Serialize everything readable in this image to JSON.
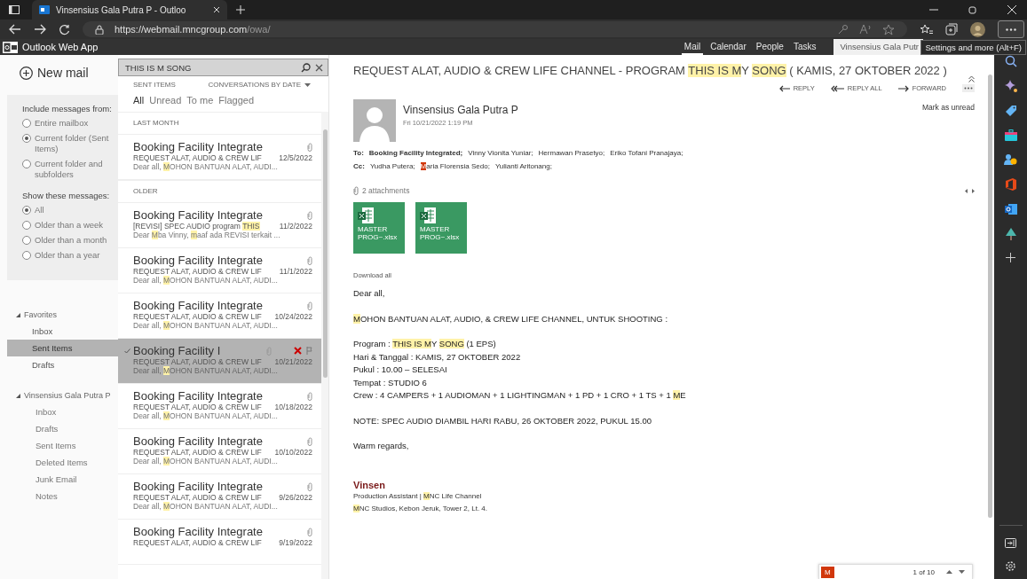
{
  "browser": {
    "tab_title": "Vinsensius Gala Putra P - Outloo",
    "url_host": "https://webmail.mncgroup.com",
    "url_path": "/owa/",
    "tooltip": "Settings and more (Alt+F)"
  },
  "app": {
    "title": "Outlook Web App",
    "nav": [
      {
        "label": "Mail",
        "selected": true
      },
      {
        "label": "Calendar",
        "selected": false
      },
      {
        "label": "People",
        "selected": false
      },
      {
        "label": "Tasks",
        "selected": false
      }
    ],
    "user": "Vinsensius Gala Putr"
  },
  "sidebar": {
    "new_mail": "New mail",
    "include": {
      "title": "Include messages from:",
      "options": [
        {
          "label": "Entire mailbox",
          "selected": false
        },
        {
          "label": "Current folder (Sent Items)",
          "selected": true
        },
        {
          "label": "Current folder and subfolders",
          "selected": false
        }
      ]
    },
    "show": {
      "title": "Show these messages:",
      "options": [
        {
          "label": "All",
          "selected": true
        },
        {
          "label": "Older than a week",
          "selected": false
        },
        {
          "label": "Older than a month",
          "selected": false
        },
        {
          "label": "Older than a year",
          "selected": false
        }
      ]
    },
    "sections": [
      {
        "label": "Favorites",
        "expanded": true,
        "children": [
          {
            "label": "Inbox",
            "selected": false
          },
          {
            "label": "Sent Items",
            "selected": true
          },
          {
            "label": "Drafts",
            "selected": false
          }
        ]
      },
      {
        "label": "Vinsensius Gala Putra P",
        "expanded": true,
        "children": [
          {
            "label": "Inbox",
            "selected": false
          },
          {
            "label": "Drafts",
            "selected": false
          },
          {
            "label": "Sent Items",
            "selected": false
          },
          {
            "label": "Deleted Items",
            "selected": false
          },
          {
            "label": "Junk Email",
            "selected": false
          },
          {
            "label": "Notes",
            "selected": false
          }
        ]
      }
    ]
  },
  "list": {
    "search": "THIS IS M SONG",
    "folder": "SENT ITEMS",
    "sort": "CONVERSATIONS BY DATE",
    "filters": [
      {
        "label": "All",
        "selected": true
      },
      {
        "label": "Unread",
        "selected": false
      },
      {
        "label": "To me",
        "selected": false
      },
      {
        "label": "Flagged",
        "selected": false
      }
    ],
    "groups": [
      {
        "label": "LAST MONTH",
        "items": [
          {
            "sender": "Booking Facility Integrate",
            "subject": [
              {
                "text": "REQUEST ALAT, AUDIO & CREW LIF",
                "highlight": false
              }
            ],
            "date": "12/5/2022",
            "preview": [
              {
                "text": "Dear all, ",
                "highlight": false
              },
              {
                "text": "M",
                "highlight": true
              },
              {
                "text": "OHON BANTUAN ALAT, AUDI...",
                "highlight": false
              }
            ],
            "selected": false
          }
        ]
      },
      {
        "label": "OLDER",
        "items": [
          {
            "sender": "Booking Facility Integrate",
            "subject": [
              {
                "text": "[REVISI] SPEC AUDIO program ",
                "highlight": false
              },
              {
                "text": "THIS",
                "highlight": true
              }
            ],
            "date": "11/2/2022",
            "preview": [
              {
                "text": "Dear ",
                "highlight": false
              },
              {
                "text": "M",
                "highlight": true
              },
              {
                "text": "ba Vinny, ",
                "highlight": false
              },
              {
                "text": "m",
                "highlight": true
              },
              {
                "text": "aaf ada REVISI terkait ...",
                "highlight": false
              }
            ],
            "selected": false
          },
          {
            "sender": "Booking Facility Integrate",
            "subject": [
              {
                "text": "REQUEST ALAT, AUDIO & CREW LIF",
                "highlight": false
              }
            ],
            "date": "11/1/2022",
            "preview": [
              {
                "text": "Dear all, ",
                "highlight": false
              },
              {
                "text": "M",
                "highlight": true
              },
              {
                "text": "OHON BANTUAN ALAT, AUDI...",
                "highlight": false
              }
            ],
            "selected": false
          },
          {
            "sender": "Booking Facility Integrate",
            "subject": [
              {
                "text": "REQUEST ALAT, AUDIO & CREW LIF",
                "highlight": false
              }
            ],
            "date": "10/24/2022",
            "preview": [
              {
                "text": "Dear all, ",
                "highlight": false
              },
              {
                "text": "M",
                "highlight": true
              },
              {
                "text": "OHON BANTUAN ALAT, AUDI...",
                "highlight": false
              }
            ],
            "selected": false
          },
          {
            "sender": "Booking Facility I",
            "subject": [
              {
                "text": "REQUEST ALAT, AUDIO & CREW LIF",
                "highlight": false
              }
            ],
            "date": "10/21/2022",
            "preview": [
              {
                "text": "Dear all, ",
                "highlight": false
              },
              {
                "text": "M",
                "highlight": true
              },
              {
                "text": "OHON BANTUAN ALAT, AUDI...",
                "highlight": false
              }
            ],
            "selected": true
          },
          {
            "sender": "Booking Facility Integrate",
            "subject": [
              {
                "text": "REQUEST ALAT, AUDIO & CREW LIF",
                "highlight": false
              }
            ],
            "date": "10/18/2022",
            "preview": [
              {
                "text": "Dear all, ",
                "highlight": false
              },
              {
                "text": "M",
                "highlight": true
              },
              {
                "text": "OHON BANTUAN ALAT, AUDI...",
                "highlight": false
              }
            ],
            "selected": false
          },
          {
            "sender": "Booking Facility Integrate",
            "subject": [
              {
                "text": "REQUEST ALAT, AUDIO & CREW LIF",
                "highlight": false
              }
            ],
            "date": "10/10/2022",
            "preview": [
              {
                "text": "Dear all, ",
                "highlight": false
              },
              {
                "text": "M",
                "highlight": true
              },
              {
                "text": "OHON BANTUAN ALAT, AUDI...",
                "highlight": false
              }
            ],
            "selected": false
          },
          {
            "sender": "Booking Facility Integrate",
            "subject": [
              {
                "text": "REQUEST ALAT, AUDIO & CREW LIF",
                "highlight": false
              }
            ],
            "date": "9/26/2022",
            "preview": [
              {
                "text": "Dear all, ",
                "highlight": false
              },
              {
                "text": "M",
                "highlight": true
              },
              {
                "text": "OHON BANTUAN ALAT, AUDI...",
                "highlight": false
              }
            ],
            "selected": false
          },
          {
            "sender": "Booking Facility Integrate",
            "subject": [
              {
                "text": "REQUEST ALAT, AUDIO & CREW LIF",
                "highlight": false
              }
            ],
            "date": "9/19/2022",
            "selected": false
          }
        ]
      }
    ]
  },
  "message": {
    "subject": [
      {
        "text": "REQUEST ALAT, AUDIO & CREW LIFE CHANNEL - PROGRAM ",
        "highlight": false
      },
      {
        "text": "THIS IS ",
        "highlight": true
      },
      {
        "text": "M",
        "highlight": true
      },
      {
        "text": "Y ",
        "highlight": false
      },
      {
        "text": "SONG",
        "highlight": true
      },
      {
        "text": " ( KAMIS, 27 OKTOBER 2022 )",
        "highlight": false
      }
    ],
    "actions": [
      "REPLY",
      "REPLY ALL",
      "FORWARD"
    ],
    "mark_unread": "Mark as unread",
    "sender": "Vinsensius Gala Putra P",
    "sent": "Fri 10/21/2022 1:19 PM",
    "to_label": "To:",
    "to": [
      {
        "text": "Booking Facility Integrated;",
        "bold": true
      },
      {
        "text": "Vinny Vionita Yuniar;",
        "bold": false
      },
      {
        "text": "Hermawan Prasetyo;",
        "bold": false
      },
      {
        "text": "Eriko Tofani Pranajaya;",
        "bold": false
      }
    ],
    "cc_label": "Cc:",
    "cc": [
      {
        "parts": [
          {
            "text": "Yudha Putera;",
            "current": false
          }
        ]
      },
      {
        "parts": [
          {
            "text": "M",
            "current": true
          },
          {
            "text": "aria Florensia Sedo;",
            "current": false
          }
        ]
      },
      {
        "parts": [
          {
            "text": "Yulianti Aritonang;",
            "current": false
          }
        ]
      }
    ],
    "attachments_label": "2 attachments",
    "attachments": [
      "MASTER PROG~.xlsx",
      "MASTER PROG~.xlsx"
    ],
    "download_all": "Download all",
    "body": [
      [
        [
          {
            "text": "Dear all,",
            "highlight": false
          }
        ]
      ],
      [
        [
          {
            "text": "M",
            "highlight": true
          },
          {
            "text": "OHON BANTUAN ALAT, AUDIO, & CREW LIFE CHANNEL, UNTUK SHOOTING :",
            "highlight": false
          }
        ]
      ],
      [
        [
          {
            "text": "Program : ",
            "highlight": false
          },
          {
            "text": "THIS IS ",
            "highlight": true
          },
          {
            "text": "M",
            "highlight": true
          },
          {
            "text": "Y ",
            "highlight": false
          },
          {
            "text": "SONG",
            "highlight": true
          },
          {
            "text": " (1 EPS)",
            "highlight": false
          }
        ],
        [
          {
            "text": "Hari & Tanggal : KAMIS, 27 OKTOBER 2022",
            "highlight": false
          }
        ],
        [
          {
            "text": "Pukul : 10.00 – SELESAI",
            "highlight": false
          }
        ],
        [
          {
            "text": "Tempat : STUDIO 6",
            "highlight": false
          }
        ],
        [
          {
            "text": "Crew : 4 CAMPERS + 1 AUDIOMAN + 1 LIGHTINGMAN + 1 PD + 1 CRO + 1 TS + 1 ",
            "highlight": false
          },
          {
            "text": "M",
            "highlight": true
          },
          {
            "text": "E",
            "highlight": false
          }
        ]
      ],
      [
        [
          {
            "text": "NOTE: SPEC AUDIO DIAMBIL HARI RABU, 26 OKTOBER 2022, PUKUL 15.00",
            "highlight": false
          }
        ]
      ],
      [
        [
          {
            "text": "Warm regards,",
            "highlight": false
          }
        ]
      ]
    ],
    "signature_name": "Vinsen",
    "signature": [
      [
        {
          "text": "Production Assistant | ",
          "highlight": false
        },
        {
          "text": "M",
          "highlight": true
        },
        {
          "text": "NC Life Channel",
          "highlight": false
        }
      ],
      [
        {
          "text": "M",
          "highlight": true
        },
        {
          "text": "NC Studios, Kebon Jeruk, Tower 2, Lt. 4.",
          "highlight": false
        }
      ]
    ]
  },
  "find_bar": {
    "badge": "M",
    "count": "1 of 10"
  }
}
